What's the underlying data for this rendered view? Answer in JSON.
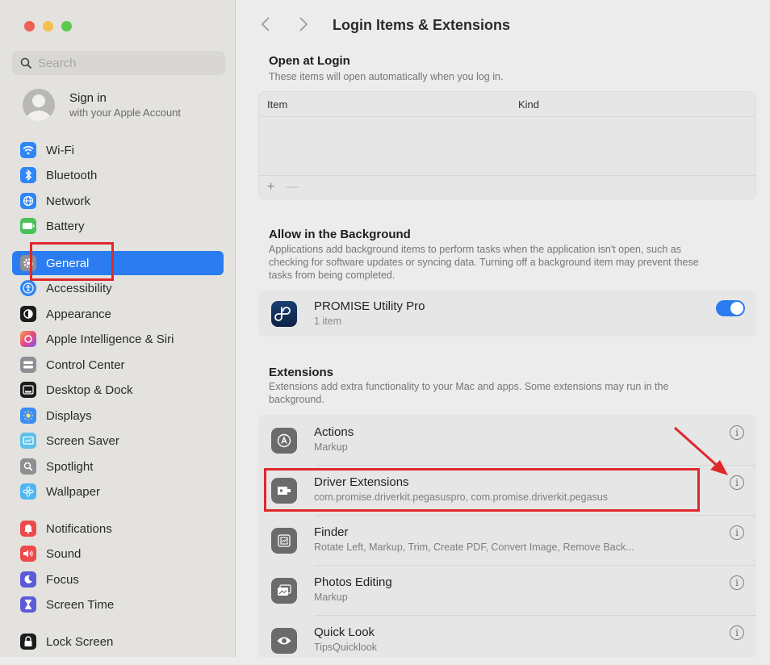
{
  "sidebar": {
    "search_placeholder": "Search",
    "account": {
      "title": "Sign in",
      "subtitle": "with your Apple Account"
    },
    "items": [
      {
        "label": "Wi-Fi",
        "icon": "wifi-icon",
        "color": "#2f86f6"
      },
      {
        "label": "Bluetooth",
        "icon": "bluetooth-icon",
        "color": "#2f86f6"
      },
      {
        "label": "Network",
        "icon": "globe-icon",
        "color": "#2f86f6"
      },
      {
        "label": "Battery",
        "icon": "battery-icon",
        "color": "#49c159"
      },
      {
        "label": "General",
        "icon": "gear-icon",
        "color": "#8e8e93",
        "selected": true
      },
      {
        "label": "Accessibility",
        "icon": "accessibility-icon",
        "color": "#2f86f6"
      },
      {
        "label": "Appearance",
        "icon": "appearance-icon",
        "color": "#1c1c1e"
      },
      {
        "label": "Apple Intelligence & Siri",
        "icon": "siri-icon",
        "color": "#f0588c"
      },
      {
        "label": "Control Center",
        "icon": "control-center-icon",
        "color": "#8e8e93"
      },
      {
        "label": "Desktop & Dock",
        "icon": "dock-icon",
        "color": "#1c1c1e"
      },
      {
        "label": "Displays",
        "icon": "sun-icon",
        "color": "#3a8df5"
      },
      {
        "label": "Screen Saver",
        "icon": "screen-saver-icon",
        "color": "#5cc1ea"
      },
      {
        "label": "Spotlight",
        "icon": "magnifier-icon",
        "color": "#8e8e93"
      },
      {
        "label": "Wallpaper",
        "icon": "flower-icon",
        "color": "#4fb6ef"
      },
      {
        "label": "Notifications",
        "icon": "bell-icon",
        "color": "#ee4a4a"
      },
      {
        "label": "Sound",
        "icon": "speaker-icon",
        "color": "#ee4a4a"
      },
      {
        "label": "Focus",
        "icon": "moon-icon",
        "color": "#5b5bd6"
      },
      {
        "label": "Screen Time",
        "icon": "hourglass-icon",
        "color": "#5b5bd6"
      },
      {
        "label": "Lock Screen",
        "icon": "lock-icon",
        "color": "#1c1c1e"
      }
    ]
  },
  "main": {
    "title": "Login Items & Extensions",
    "open_at_login": {
      "title": "Open at Login",
      "subtitle": "These items will open automatically when you log in.",
      "columns": [
        "Item",
        "Kind"
      ],
      "add": "+",
      "remove": "—"
    },
    "background": {
      "title": "Allow in the Background",
      "subtitle": "Applications add background items to perform tasks when the application isn't open, such as checking for software updates or syncing data. Turning off a background item may prevent these tasks from being completed.",
      "items": [
        {
          "name": "PROMISE Utility Pro",
          "count": "1 item",
          "enabled": true
        }
      ]
    },
    "extensions": {
      "title": "Extensions",
      "subtitle": "Extensions add extra functionality to your Mac and apps. Some extensions may run in the background.",
      "info_glyph": "i",
      "items": [
        {
          "name": "Actions",
          "desc": "Markup",
          "icon": "actions-icon"
        },
        {
          "name": "Driver Extensions",
          "desc": "com.promise.driverkit.pegasuspro, com.promise.driverkit.pegasus",
          "icon": "driver-extension-icon"
        },
        {
          "name": "Finder",
          "desc": "Rotate Left, Markup, Trim, Create PDF, Convert Image, Remove Back...",
          "icon": "finder-icon"
        },
        {
          "name": "Photos Editing",
          "desc": "Markup",
          "icon": "photos-editing-icon"
        },
        {
          "name": "Quick Look",
          "desc": "TipsQuicklook",
          "icon": "eye-icon"
        }
      ]
    }
  },
  "annotation_color": "#e0282c"
}
